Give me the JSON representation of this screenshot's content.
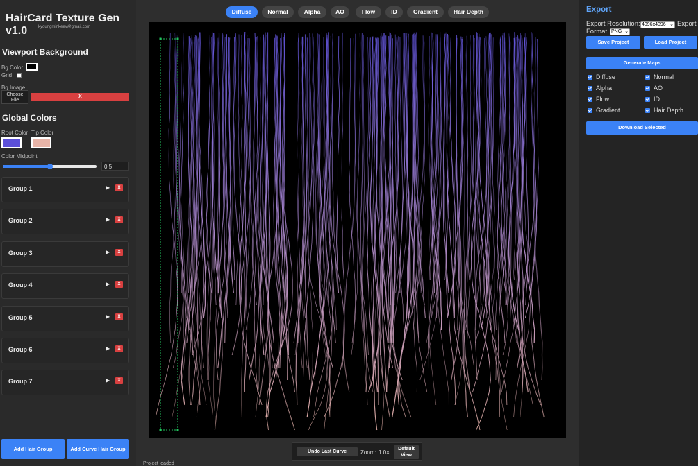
{
  "app": {
    "title": "HairCard Texture Gen v1.0",
    "subtitle": "kyoungminkeev@gmail.com"
  },
  "viewport_bg": {
    "heading": "Viewport Background",
    "bg_color_label": "Bg Color",
    "bg_color": "#000000",
    "grid_label": "Grid",
    "grid_checked": false,
    "bg_image_label": "Bg Image",
    "choose_file_label": "Choose File",
    "clear_label": "X"
  },
  "global_colors": {
    "heading": "Global Colors",
    "root_label": "Root Color",
    "tip_label": "Tip Color",
    "root_color": "#5b4fd8",
    "tip_color": "#e8b4a8",
    "midpoint_label": "Color Midpoint",
    "midpoint_value": "0.5"
  },
  "groups": [
    {
      "name": "Group 1",
      "toggle": "▶",
      "delete": "X"
    },
    {
      "name": "Group 2",
      "toggle": "▶",
      "delete": "X"
    },
    {
      "name": "Group 3",
      "toggle": "▶",
      "delete": "X"
    },
    {
      "name": "Group 4",
      "toggle": "▶",
      "delete": "X"
    },
    {
      "name": "Group 5",
      "toggle": "▶",
      "delete": "X"
    },
    {
      "name": "Group 6",
      "toggle": "▶",
      "delete": "X"
    },
    {
      "name": "Group 7",
      "toggle": "▶",
      "delete": "X"
    }
  ],
  "sidebar_buttons": {
    "add_hair_group": "Add Hair Group",
    "add_curve_hair_group": "Add Curve Hair Group"
  },
  "tabs": [
    {
      "label": "Diffuse",
      "active": true
    },
    {
      "label": "Normal",
      "active": false
    },
    {
      "label": "Alpha",
      "active": false
    },
    {
      "label": "AO",
      "active": false
    },
    {
      "label": "Flow",
      "active": false
    },
    {
      "label": "ID",
      "active": false
    },
    {
      "label": "Gradient",
      "active": false
    },
    {
      "label": "Hair Depth",
      "active": false
    }
  ],
  "canvas_controls": {
    "undo_label": "Undo Last Curve",
    "zoom_label": "Zoom:",
    "zoom_value": "1.0×",
    "default_view_label": "Default View"
  },
  "status": "Project loaded",
  "export": {
    "heading": "Export",
    "resolution_label": "Export Resolution:",
    "resolution_value": "4096x4096",
    "format_label": "Export Format:",
    "format_value": "PNG",
    "save_label": "Save Project",
    "load_label": "Load Project",
    "generate_label": "Generate Maps",
    "maps": [
      {
        "label": "Diffuse",
        "checked": true
      },
      {
        "label": "Normal",
        "checked": true
      },
      {
        "label": "Alpha",
        "checked": true
      },
      {
        "label": "AO",
        "checked": true
      },
      {
        "label": "Flow",
        "checked": true
      },
      {
        "label": "ID",
        "checked": true
      },
      {
        "label": "Gradient",
        "checked": true
      },
      {
        "label": "Hair Depth",
        "checked": true
      }
    ],
    "download_label": "Download Selected"
  },
  "colors": {
    "accent": "#3b82f6",
    "danger": "#d84040",
    "export_heading": "#60a5fa"
  }
}
